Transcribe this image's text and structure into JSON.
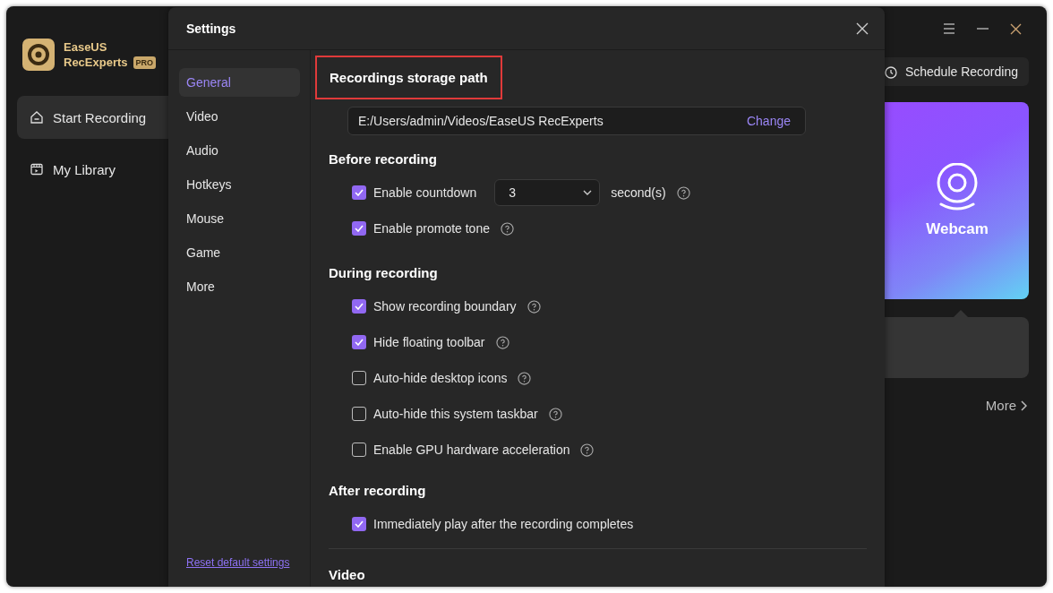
{
  "app": {
    "logo": {
      "line_1": "EaseUS",
      "line_2": "RecExperts",
      "badge": "PRO"
    },
    "nav": [
      {
        "label": "Start Recording",
        "selected": true
      },
      {
        "label": "My Library",
        "selected": false
      }
    ],
    "schedule_button": "Schedule Recording",
    "mode_card": {
      "label": "Webcam"
    },
    "more_link": "More"
  },
  "settings": {
    "title": "Settings",
    "nav": [
      {
        "label": "General",
        "selected": true
      },
      {
        "label": "Video",
        "selected": false
      },
      {
        "label": "Audio",
        "selected": false
      },
      {
        "label": "Hotkeys",
        "selected": false
      },
      {
        "label": "Mouse",
        "selected": false
      },
      {
        "label": "Game",
        "selected": false
      },
      {
        "label": "More",
        "selected": false
      }
    ],
    "reset_link": "Reset default settings",
    "storage": {
      "heading": "Recordings storage path",
      "highlighted": true,
      "path": "E:/Users/admin/Videos/EaseUS RecExperts",
      "action": "Change"
    },
    "sections": [
      {
        "title": "Before recording",
        "options": [
          {
            "kind": "countdown",
            "label": "Enable countdown",
            "checked": true,
            "value": "3",
            "unit": "second(s)",
            "help": true
          },
          {
            "kind": "checkbox",
            "label": "Enable promote tone",
            "checked": true,
            "help": true
          }
        ]
      },
      {
        "title": "During recording",
        "options": [
          {
            "kind": "checkbox",
            "label": "Show recording boundary",
            "checked": true,
            "help": true
          },
          {
            "kind": "checkbox",
            "label": "Hide floating toolbar",
            "checked": true,
            "help": true
          },
          {
            "kind": "checkbox",
            "label": "Auto-hide desktop icons",
            "checked": false,
            "help": true
          },
          {
            "kind": "checkbox",
            "label": "Auto-hide this system taskbar",
            "checked": false,
            "help": true
          },
          {
            "kind": "checkbox",
            "label": "Enable GPU hardware acceleration",
            "checked": false,
            "help": true
          }
        ]
      },
      {
        "title": "After recording",
        "options": [
          {
            "kind": "checkbox",
            "label": "Immediately play after the recording completes",
            "checked": true,
            "help": false
          }
        ]
      }
    ],
    "next_section": "Video"
  }
}
